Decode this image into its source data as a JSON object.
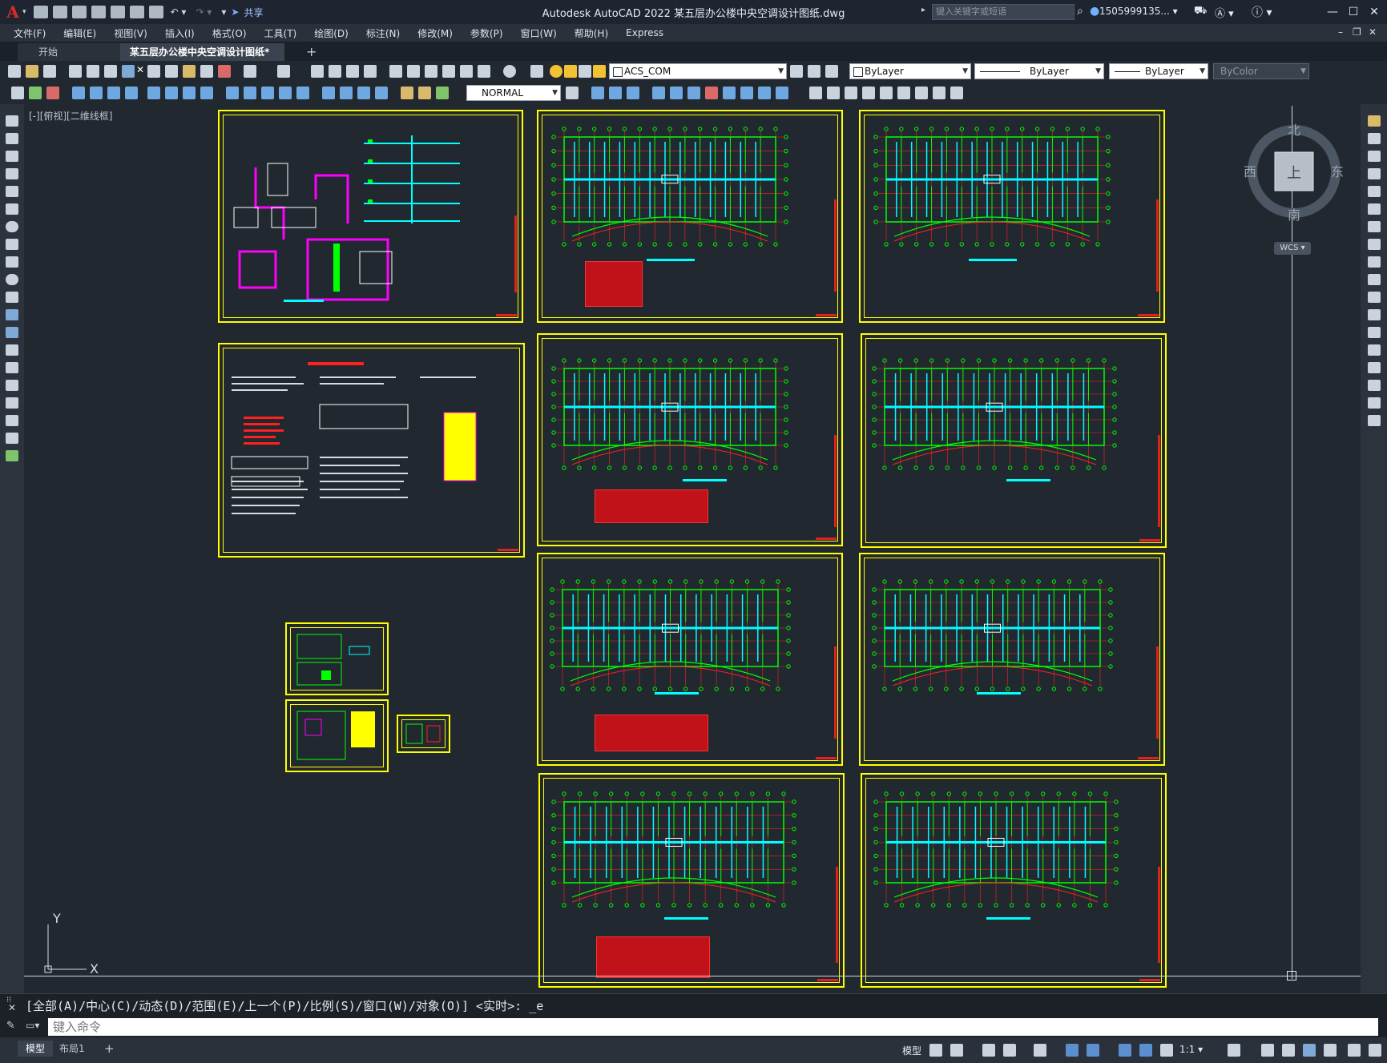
{
  "app": {
    "logo": "A",
    "title": "Autodesk AutoCAD 2022    某五层办公楼中央空调设计图纸.dwg",
    "share_label": "共享",
    "search_placeholder": "键入关键字或短语",
    "user": "1505999135... ▾",
    "window_buttons": [
      "—",
      "☐",
      "✕"
    ]
  },
  "menu": [
    "文件(F)",
    "编辑(E)",
    "视图(V)",
    "插入(I)",
    "格式(O)",
    "工具(T)",
    "绘图(D)",
    "标注(N)",
    "修改(M)",
    "参数(P)",
    "窗口(W)",
    "帮助(H)",
    "Express"
  ],
  "tabs": {
    "start": "开始",
    "drawing": "某五层办公楼中央空调设计图纸*",
    "close": "✕",
    "add": "+"
  },
  "toolbar": {
    "layer": "ACS_COM",
    "color": "ByLayer",
    "linetype": "ByLayer",
    "lineweight": "ByLayer",
    "plotstyle": "ByColor",
    "dimstyle": "NORMAL"
  },
  "viewport": {
    "label": "[-][俯视][二维线框]"
  },
  "viewcube": {
    "north": "北",
    "south": "南",
    "east": "东",
    "west": "西",
    "face": "上",
    "wcs": "WCS ▾"
  },
  "ucs": {
    "x": "X",
    "y": "Y"
  },
  "command": {
    "history": "[全部(A)/中心(C)/动态(D)/范围(E)/上一个(P)/比例(S)/窗口(W)/对象(O)] <实时>: _e",
    "placeholder": "键入命令"
  },
  "status": {
    "model_tab": "模型",
    "layout_tab": "布局1",
    "add_tab": "+",
    "model_label": "模型",
    "scale": "1:1 ▾"
  },
  "colors": {
    "background": "#212830",
    "frame": "#ffff00",
    "wall": "#00ff00",
    "duct": "#00ffff",
    "grid_red": "#ff2020",
    "pipe_magenta": "#ff00ff"
  }
}
